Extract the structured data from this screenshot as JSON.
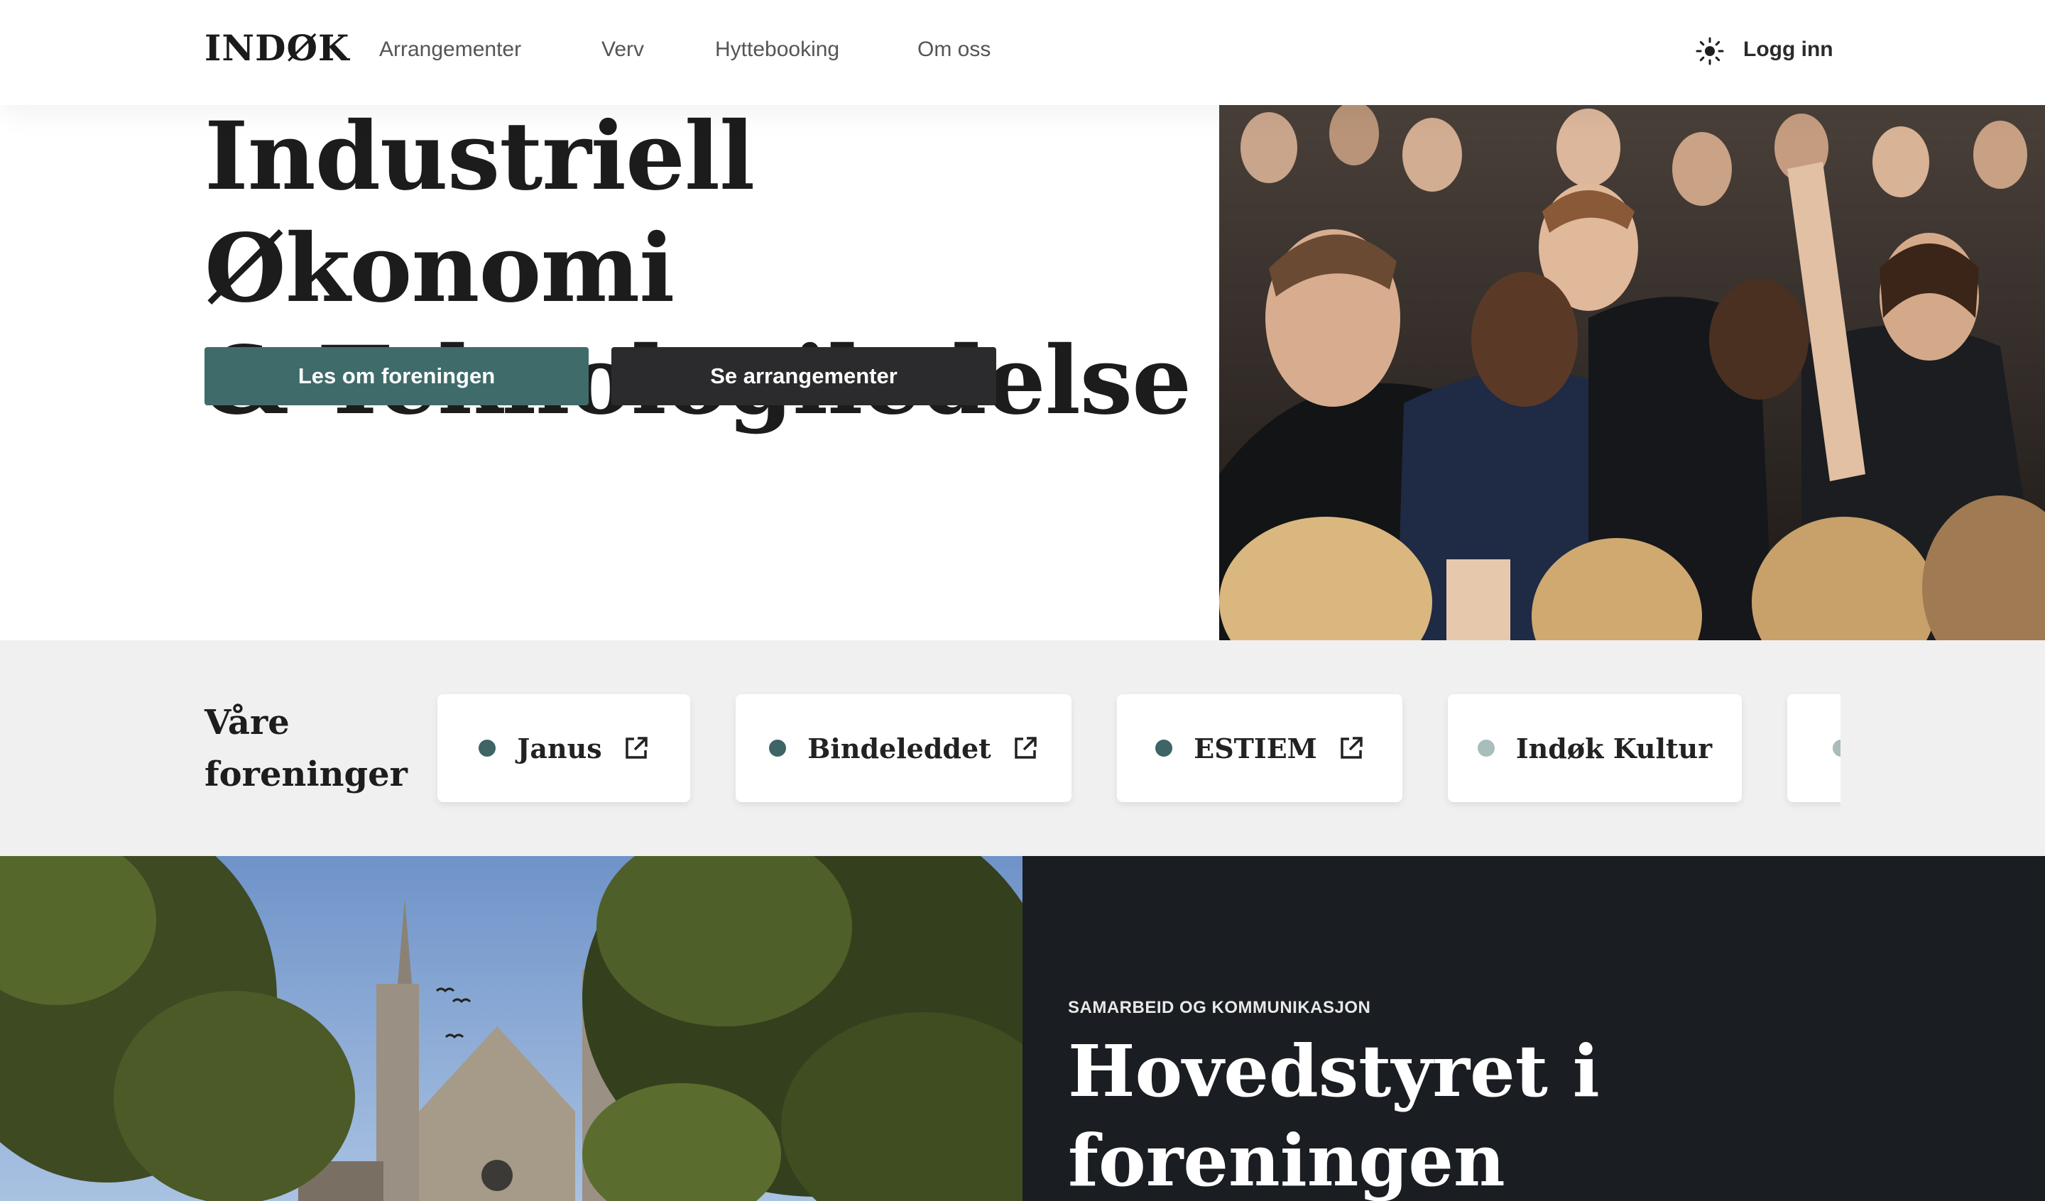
{
  "header": {
    "logo": "INDØK",
    "nav": [
      {
        "label": "Arrangementer"
      },
      {
        "label": "Verv"
      },
      {
        "label": "Hyttebooking"
      },
      {
        "label": "Om oss"
      }
    ],
    "theme_icon": "sun-icon",
    "login_label": "Logg inn"
  },
  "hero": {
    "title_line1": "Industriell Økonomi",
    "title_line2": "& Teknologiledelse",
    "primary_button": "Les om foreningen",
    "secondary_button": "Se arrangementer",
    "accent_color": "#3f6b6b",
    "dark_button_color": "#2b2b2d"
  },
  "associations": {
    "heading_line1": "Våre",
    "heading_line2": "foreninger",
    "items": [
      {
        "name": "Janus",
        "dot_color": "#3e6465",
        "external": true
      },
      {
        "name": "Bindeleddet",
        "dot_color": "#3e6465",
        "external": true
      },
      {
        "name": "ESTIEM",
        "dot_color": "#3e6465",
        "external": true
      },
      {
        "name": "Indøk Kultur",
        "dot_color": "#a9bdbb",
        "external": false
      },
      {
        "name": "",
        "dot_color": "#a9bdbb",
        "external": false
      }
    ]
  },
  "board": {
    "kicker": "SAMARBEID OG KOMMUNIKASJON",
    "title_line1": "Hovedstyret i",
    "title_line2": "foreningen",
    "panel_color": "#1a1d22"
  }
}
